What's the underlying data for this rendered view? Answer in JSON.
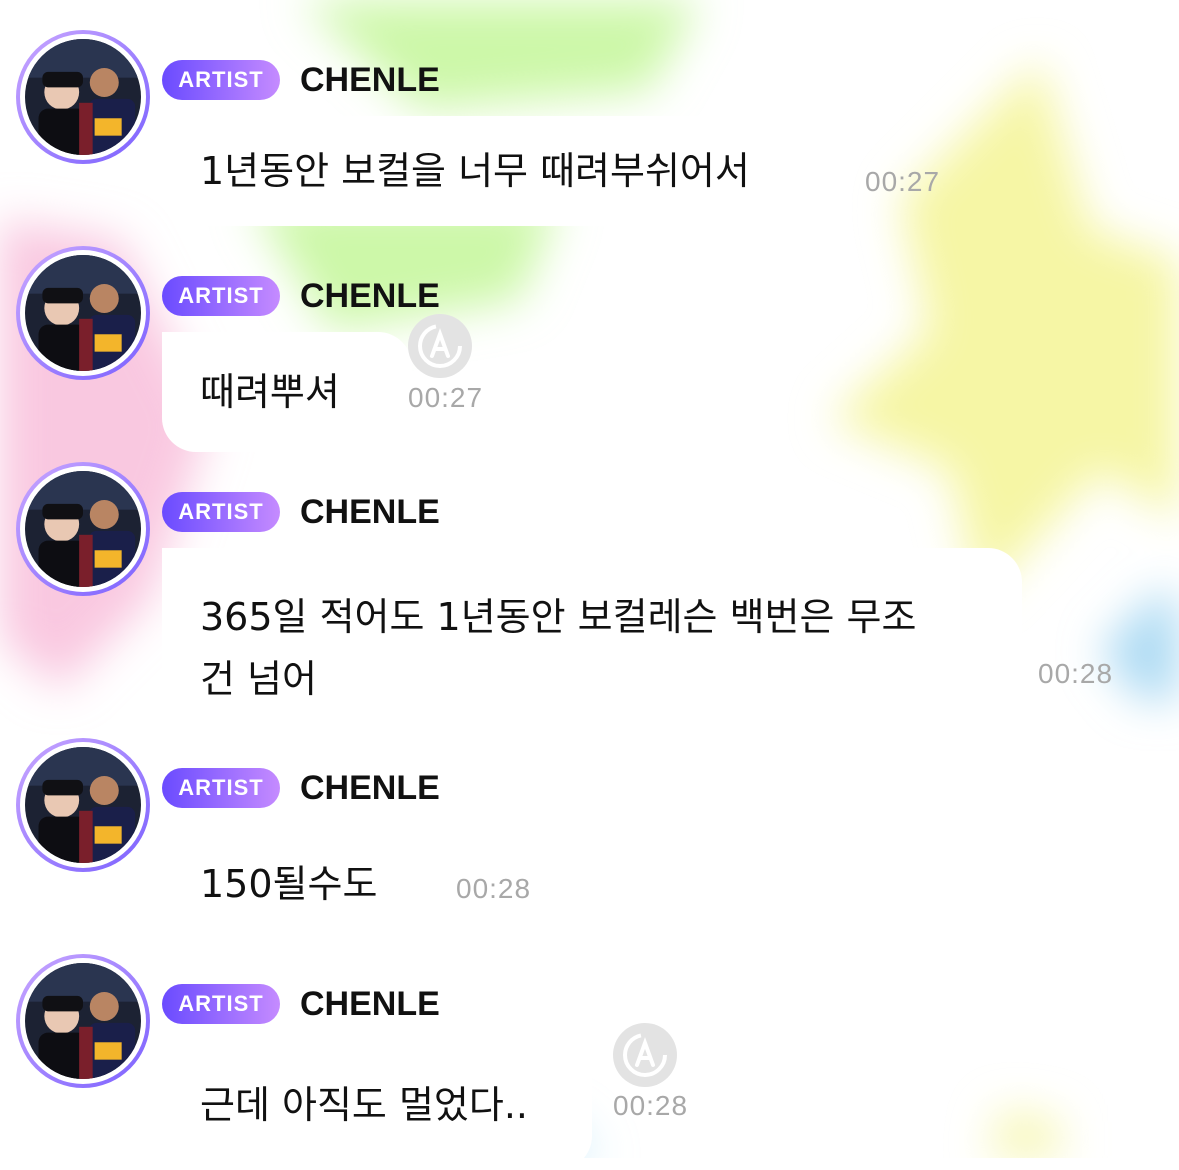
{
  "chat": {
    "messages": [
      {
        "badge": "ARTIST",
        "name": "CHENLE",
        "lines": [
          "1년동안 보컬을 너무 때려부쉬어서"
        ],
        "time": "00:27",
        "translate_icon": false
      },
      {
        "badge": "ARTIST",
        "name": "CHENLE",
        "lines": [
          "때려뿌셔"
        ],
        "time": "00:27",
        "translate_icon": true
      },
      {
        "badge": "ARTIST",
        "name": "CHENLE",
        "lines": [
          "365일 적어도 1년동안 보컬레슨 백번은 무조",
          "건 넘어"
        ],
        "time": "00:28",
        "translate_icon": false
      },
      {
        "badge": "ARTIST",
        "name": "CHENLE",
        "lines": [
          "150될수도"
        ],
        "time": "00:28",
        "translate_icon": false
      },
      {
        "badge": "ARTIST",
        "name": "CHENLE",
        "lines": [
          "근데 아직도 멀었다.."
        ],
        "time": "00:28",
        "translate_icon": true
      }
    ]
  },
  "icons": {
    "avatar": "avatar-photo",
    "translate": "translate-icon"
  },
  "colors": {
    "badge_start": "#6a4bff",
    "badge_end": "#c58bff",
    "timestamp": "#a8a8a8"
  }
}
